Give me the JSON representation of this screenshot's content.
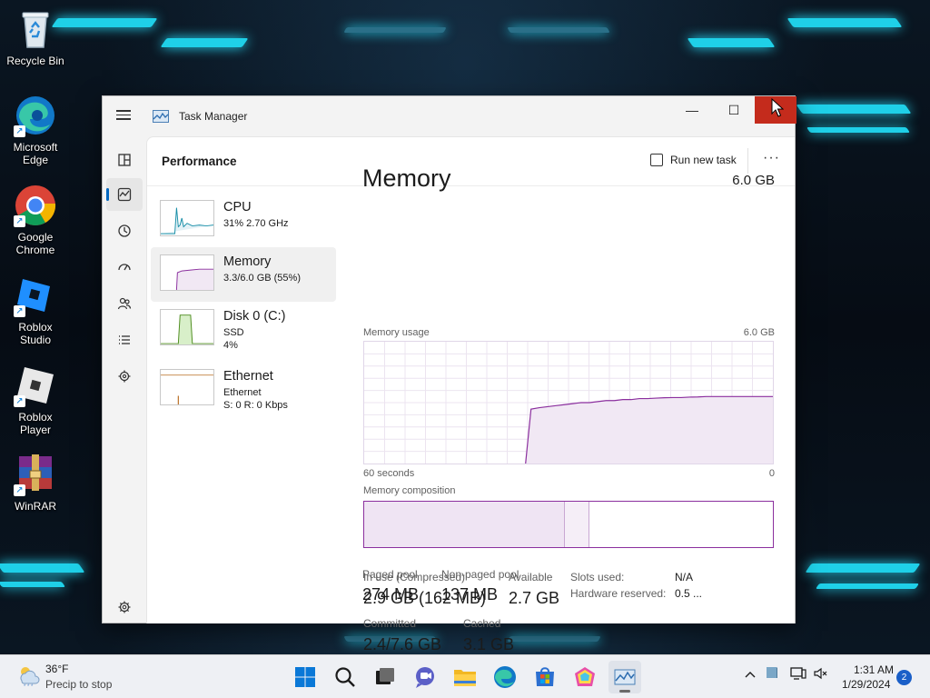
{
  "desktop": {
    "icons": [
      {
        "label": "Recycle Bin"
      },
      {
        "label": "Microsoft Edge"
      },
      {
        "label": "Google Chrome"
      },
      {
        "label": "Roblox Studio"
      },
      {
        "label": "Roblox Player"
      },
      {
        "label": "WinRAR"
      }
    ]
  },
  "window": {
    "title": "Task Manager",
    "controls": {
      "minimize": "—",
      "maximize": "☐",
      "close": "✕"
    }
  },
  "nav": {
    "icons": [
      "processes-icon",
      "performance-icon",
      "app-history-icon",
      "startup-apps-icon",
      "users-icon",
      "details-icon",
      "services-icon",
      "settings-icon"
    ]
  },
  "header": {
    "title": "Performance",
    "run_task": "Run new task",
    "more": "···"
  },
  "resources": [
    {
      "name": "CPU",
      "sub1": "31%  2.70 GHz",
      "sub2": ""
    },
    {
      "name": "Memory",
      "sub1": "3.3/6.0 GB (55%)",
      "sub2": ""
    },
    {
      "name": "Disk 0 (C:)",
      "sub1": "SSD",
      "sub2": "4%"
    },
    {
      "name": "Ethernet",
      "sub1": "Ethernet",
      "sub2": "S: 0 R: 0 Kbps"
    }
  ],
  "memory": {
    "title": "Memory",
    "total": "6.0 GB",
    "usage_label": "Memory usage",
    "usage_max": "6.0 GB",
    "time_left": "60 seconds",
    "time_right": "0",
    "composition_label": "Memory composition",
    "usage_series": [
      0,
      0,
      0,
      0,
      0,
      0,
      0,
      0,
      0,
      0,
      0,
      0,
      0,
      0,
      0,
      0,
      0,
      0,
      0,
      0,
      2.68,
      2.75,
      2.8,
      2.85,
      2.9,
      2.95,
      3.0,
      3.0,
      3.05,
      3.1,
      3.1,
      3.15,
      3.15,
      3.2,
      3.2,
      3.22,
      3.24,
      3.25,
      3.25,
      3.27,
      3.28,
      3.3,
      3.3,
      3.3,
      3.3,
      3.3,
      3.3,
      3.3,
      3.3,
      3.3
    ],
    "composition": {
      "in_use_fraction": 0.49,
      "modified_fraction": 0.06
    },
    "stats": {
      "in_use_label": "In use (Compressed)",
      "in_use": "2.9 GB (162 MB)",
      "available_label": "Available",
      "available": "2.7 GB",
      "committed_label": "Committed",
      "committed": "2.4/7.6 GB",
      "cached_label": "Cached",
      "cached": "3.1 GB",
      "paged_label": "Paged pool",
      "paged": "274 MB",
      "nonpaged_label": "Non-paged pool",
      "nonpaged": "137 MB",
      "slots_label": "Slots used:",
      "slots": "N/A",
      "hw_reserved_label": "Hardware reserved:",
      "hw_reserved": "0.5 ..."
    }
  },
  "taskbar": {
    "weather_temp": "36°F",
    "weather_desc": "Precip to stop",
    "time": "1:31 AM",
    "date": "1/29/2024",
    "notifications": "2"
  },
  "colors": {
    "accent": "#0067c0",
    "memory": "#8b2f9e",
    "close": "#c42b1c"
  }
}
